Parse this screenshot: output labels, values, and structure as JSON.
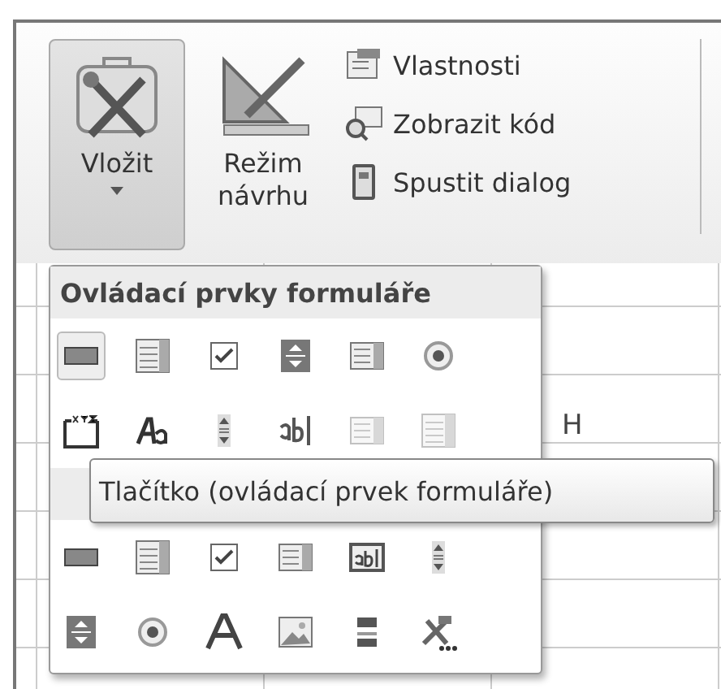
{
  "ribbon": {
    "large_buttons": [
      {
        "label_lines": [
          "Vložit"
        ],
        "kind": "tools",
        "selected": true,
        "dropdown": true
      },
      {
        "label_lines": [
          "Režim",
          "návrhu"
        ],
        "kind": "ruler-pencil",
        "selected": false,
        "dropdown": false
      }
    ],
    "small_buttons": [
      {
        "label": "Vlastnosti",
        "kind": "properties"
      },
      {
        "label": "Zobrazit kód",
        "kind": "view-code"
      },
      {
        "label": "Spustit dialog",
        "kind": "dialog"
      }
    ]
  },
  "sheet": {
    "column_header": "H"
  },
  "popup": {
    "sections": [
      {
        "title": "Ovládací prvky formuláře",
        "rows": [
          [
            {
              "kind": "button",
              "selected": true,
              "disabled": false
            },
            {
              "kind": "combo",
              "selected": false,
              "disabled": false
            },
            {
              "kind": "checkbox",
              "selected": false,
              "disabled": false
            },
            {
              "kind": "spin",
              "selected": false,
              "disabled": false
            },
            {
              "kind": "list",
              "selected": false,
              "disabled": false
            },
            {
              "kind": "option",
              "selected": false,
              "disabled": false
            }
          ],
          [
            {
              "kind": "groupbox",
              "selected": false,
              "disabled": false
            },
            {
              "kind": "label",
              "selected": false,
              "disabled": false
            },
            {
              "kind": "scrollbar",
              "selected": false,
              "disabled": false
            },
            {
              "kind": "textfield",
              "selected": false,
              "disabled": false
            },
            {
              "kind": "list",
              "selected": false,
              "disabled": true
            },
            {
              "kind": "combo",
              "selected": false,
              "disabled": true
            }
          ]
        ]
      },
      {
        "rows": [
          [
            {
              "kind": "button",
              "selected": false,
              "disabled": false
            },
            {
              "kind": "combo",
              "selected": false,
              "disabled": false
            },
            {
              "kind": "checkbox",
              "selected": false,
              "disabled": false
            },
            {
              "kind": "list",
              "selected": false,
              "disabled": false
            },
            {
              "kind": "textbox",
              "selected": false,
              "disabled": false
            },
            {
              "kind": "scrollbar",
              "selected": false,
              "disabled": false
            }
          ],
          [
            {
              "kind": "spin",
              "selected": false,
              "disabled": false
            },
            {
              "kind": "option",
              "selected": false,
              "disabled": false
            },
            {
              "kind": "bigletter",
              "selected": false,
              "disabled": false
            },
            {
              "kind": "image",
              "selected": false,
              "disabled": false
            },
            {
              "kind": "toggle",
              "selected": false,
              "disabled": false
            },
            {
              "kind": "more",
              "selected": false,
              "disabled": false
            }
          ]
        ]
      }
    ]
  },
  "tooltip": {
    "text": "Tlačítko (ovládací prvek formuláře)"
  }
}
